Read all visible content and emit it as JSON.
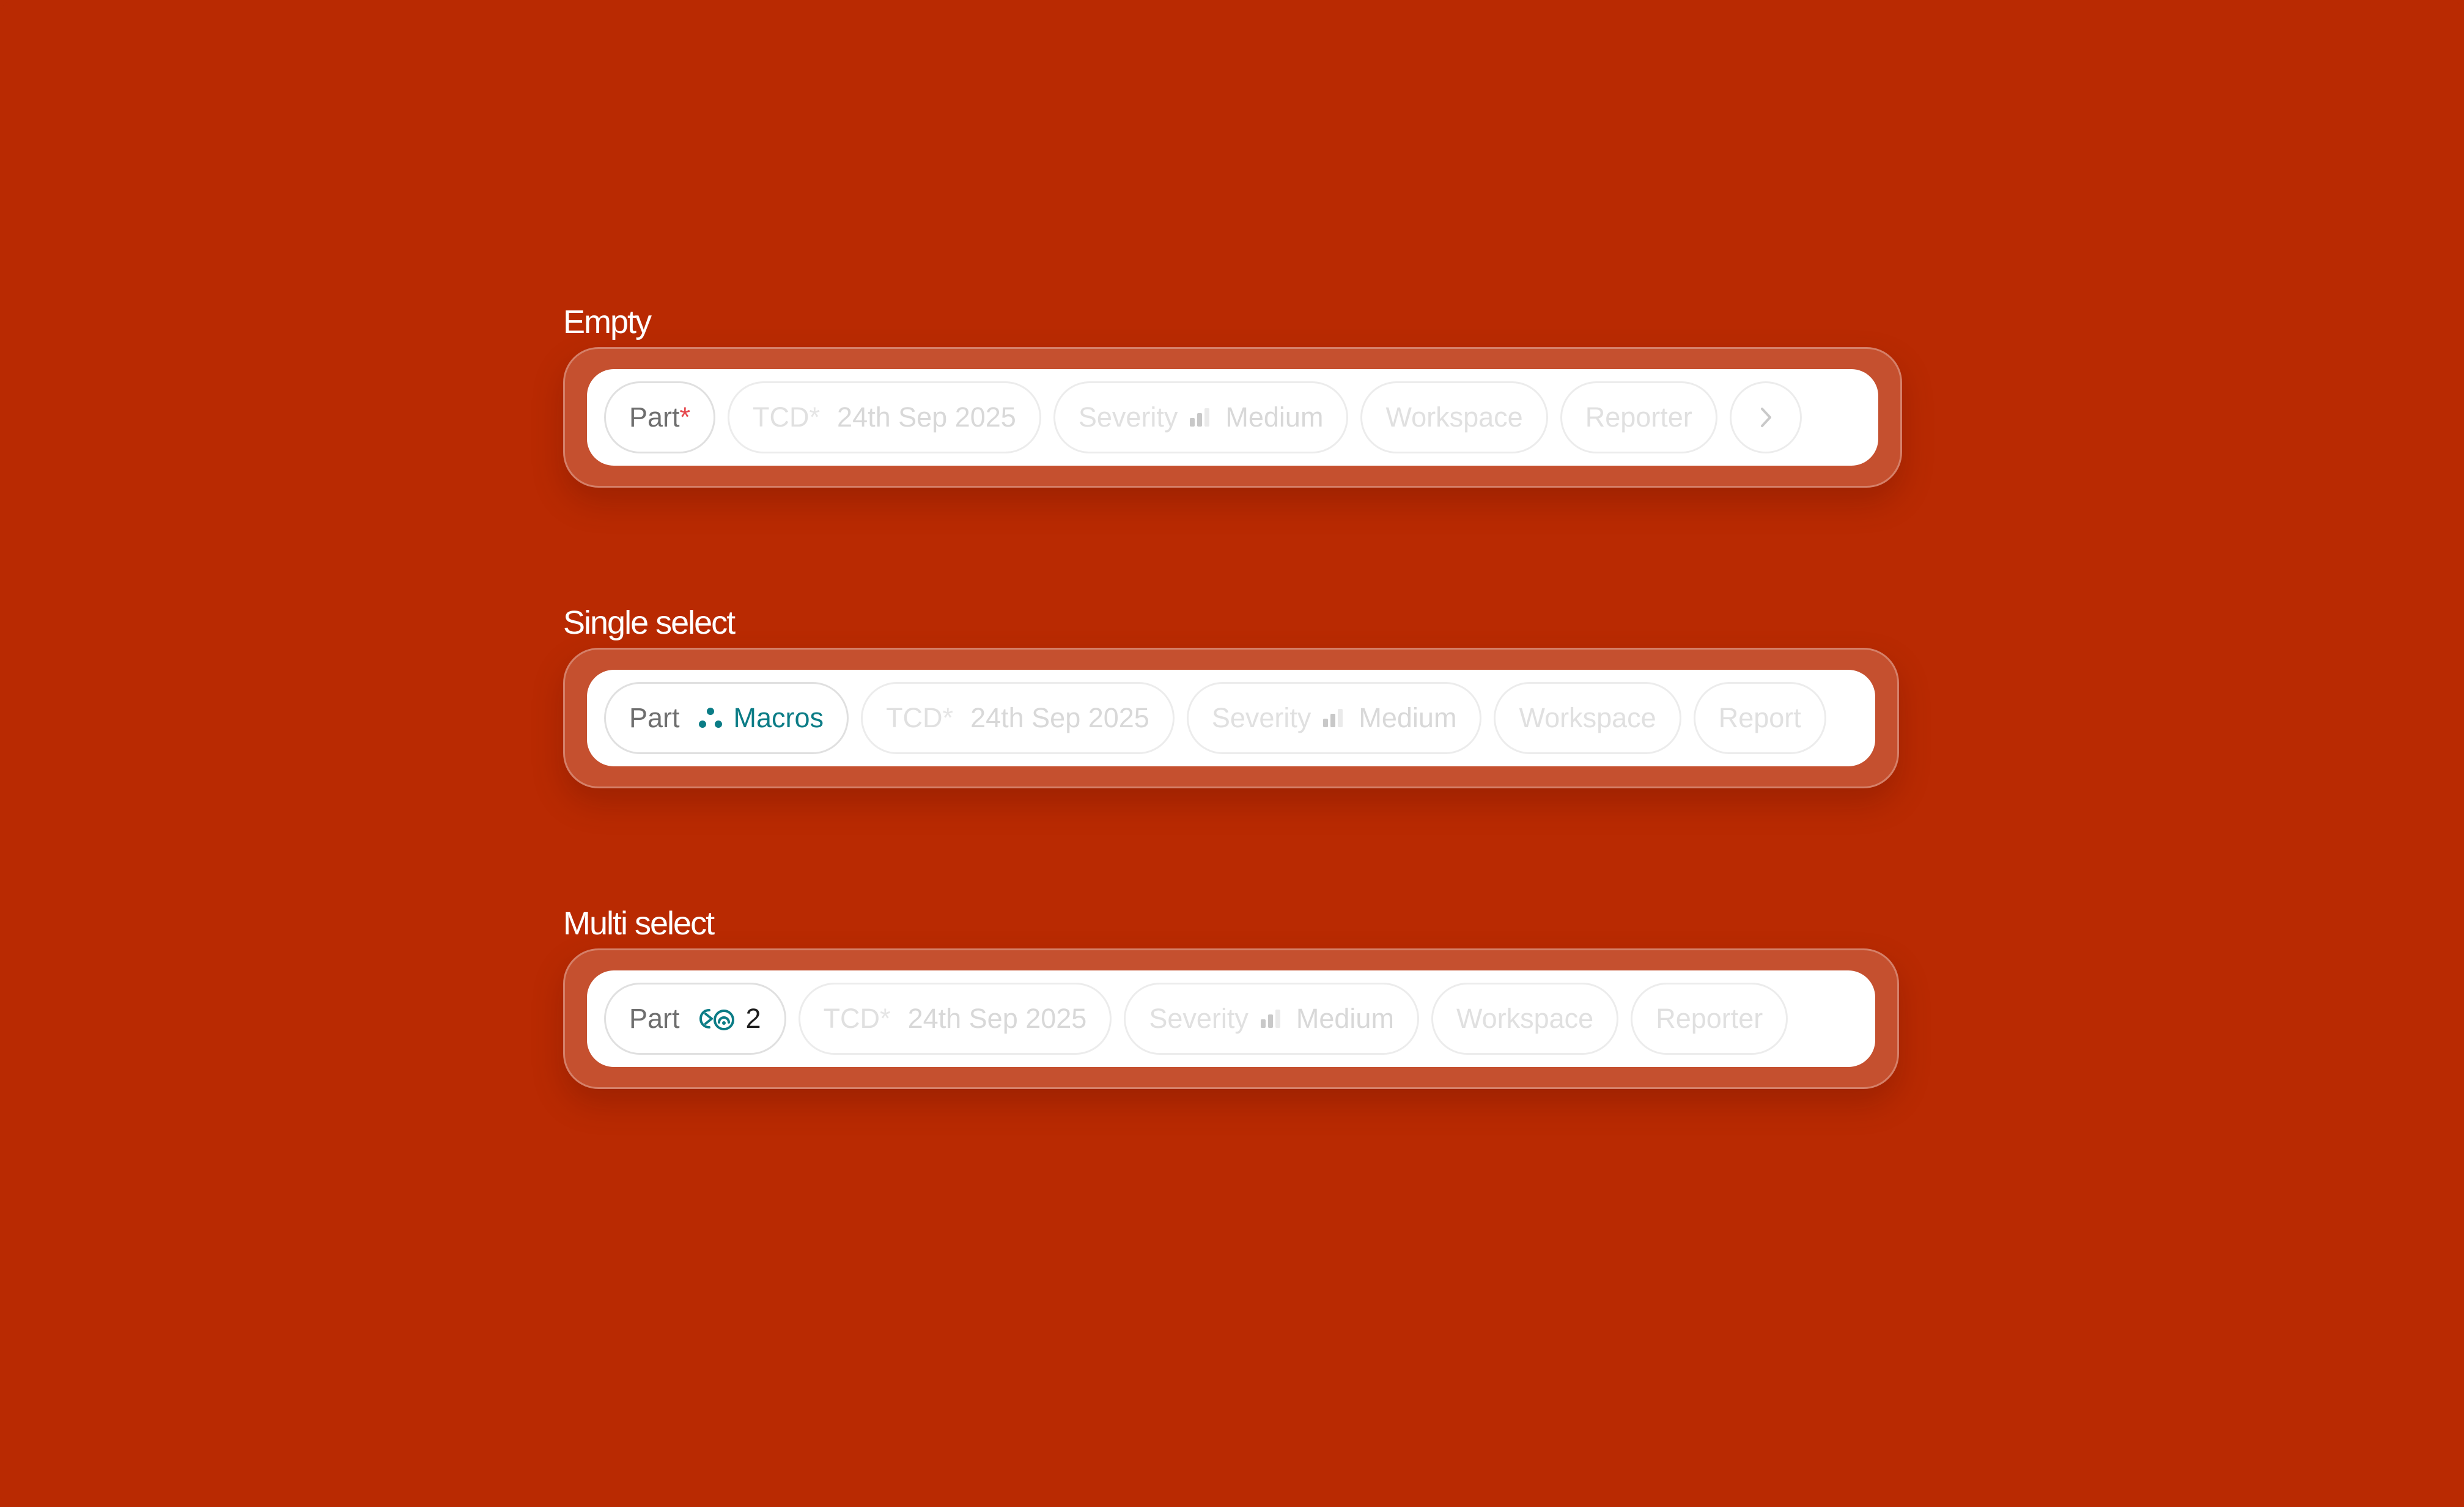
{
  "sections": [
    {
      "title": "Empty",
      "part": {
        "label": "Part",
        "required_mark": "*"
      },
      "tcd": {
        "label": "TCD",
        "required_mark": "*",
        "value": "24th Sep 2025"
      },
      "severity": {
        "label": "Severity",
        "value": "Medium",
        "icon": "severity-bars-icon"
      },
      "workspace": {
        "label": "Workspace"
      },
      "reporter": {
        "label": "Reporter"
      },
      "more_icon": "chevron-right-icon"
    },
    {
      "title": "Single select",
      "part": {
        "label": "Part",
        "value": "Macros",
        "icon": "macros-dots-icon"
      },
      "tcd": {
        "label": "TCD",
        "required_mark": "*",
        "value": "24th Sep 2025"
      },
      "severity": {
        "label": "Severity",
        "value": "Medium",
        "icon": "severity-bars-icon"
      },
      "workspace": {
        "label": "Workspace"
      },
      "reporter": {
        "label": "Report"
      }
    },
    {
      "title": "Multi select",
      "part": {
        "label": "Part",
        "count": "2",
        "icon": "multi-part-icons"
      },
      "tcd": {
        "label": "TCD",
        "required_mark": "*",
        "value": "24th Sep 2025"
      },
      "severity": {
        "label": "Severity",
        "value": "Medium",
        "icon": "severity-bars-icon"
      },
      "workspace": {
        "label": "Workspace"
      },
      "reporter": {
        "label": "Reporter"
      }
    }
  ],
  "colors": {
    "background": "#b92a02",
    "accent_teal": "#0b7c86",
    "required_red": "#e5484d"
  }
}
